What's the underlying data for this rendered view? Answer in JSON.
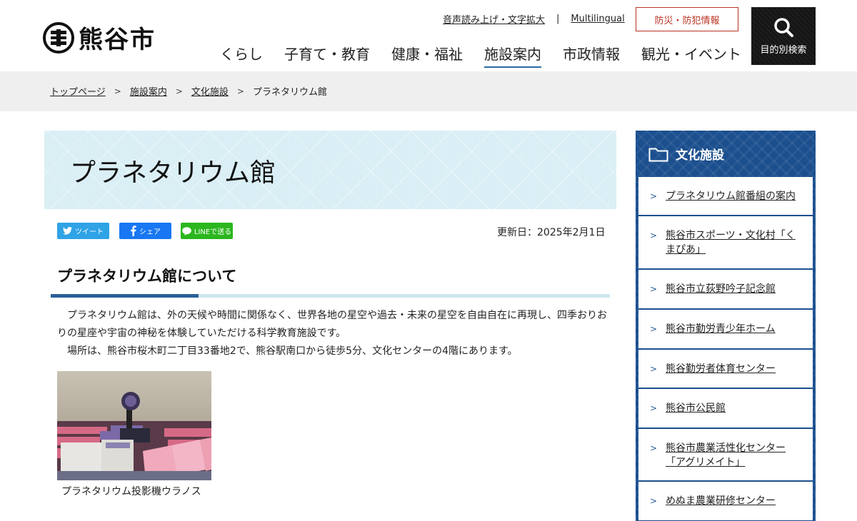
{
  "header": {
    "logo_text": "熊谷市",
    "util_links": [
      "音声読み上げ・文字拡大",
      "Multilingual"
    ],
    "util_separator": "|",
    "disaster_button": "防災・防犯情報",
    "search_label": "目的別検索",
    "nav": [
      "くらし",
      "子育て・教育",
      "健康・福祉",
      "施設案内",
      "市政情報",
      "観光・イベント"
    ]
  },
  "breadcrumb": [
    "トップページ",
    "施設案内",
    "文化施設",
    "プラネタリウム館"
  ],
  "page": {
    "title": "プラネタリウム館",
    "share": {
      "tweet": "ツイート",
      "facebook": "シェア",
      "line": "LINEで送る"
    },
    "updated": "更新日：2025年2月1日",
    "section_heading": "プラネタリウム館について",
    "paragraphs": [
      "　プラネタリウム館は、外の天候や時間に関係なく、世界各地の星空や過去・未来の星空を自由自在に再現し、四季おりおりの星座や宇宙の神秘を体験していただける科学教育施設です。",
      "　場所は、熊谷市桜木町二丁目33番地2で、熊谷駅南口から徒歩5分、文化センターの4階にあります。"
    ],
    "photo_caption": "プラネタリウム投影機ウラノス"
  },
  "sidebar": {
    "heading": "文化施設",
    "items": [
      "プラネタリウム館番組の案内",
      "熊谷市スポーツ・文化村「くまぴあ」",
      "熊谷市立荻野吟子記念館",
      "熊谷市勤労青少年ホーム",
      "熊谷勤労者体育センター",
      "熊谷市公民館",
      "熊谷市農業活性化センター「アグリメイト」",
      "めぬま農業研修センター"
    ]
  },
  "colors": {
    "accent": "#1b4f8e",
    "disaster": "#bb3322",
    "title_band": "#d8eef5"
  }
}
